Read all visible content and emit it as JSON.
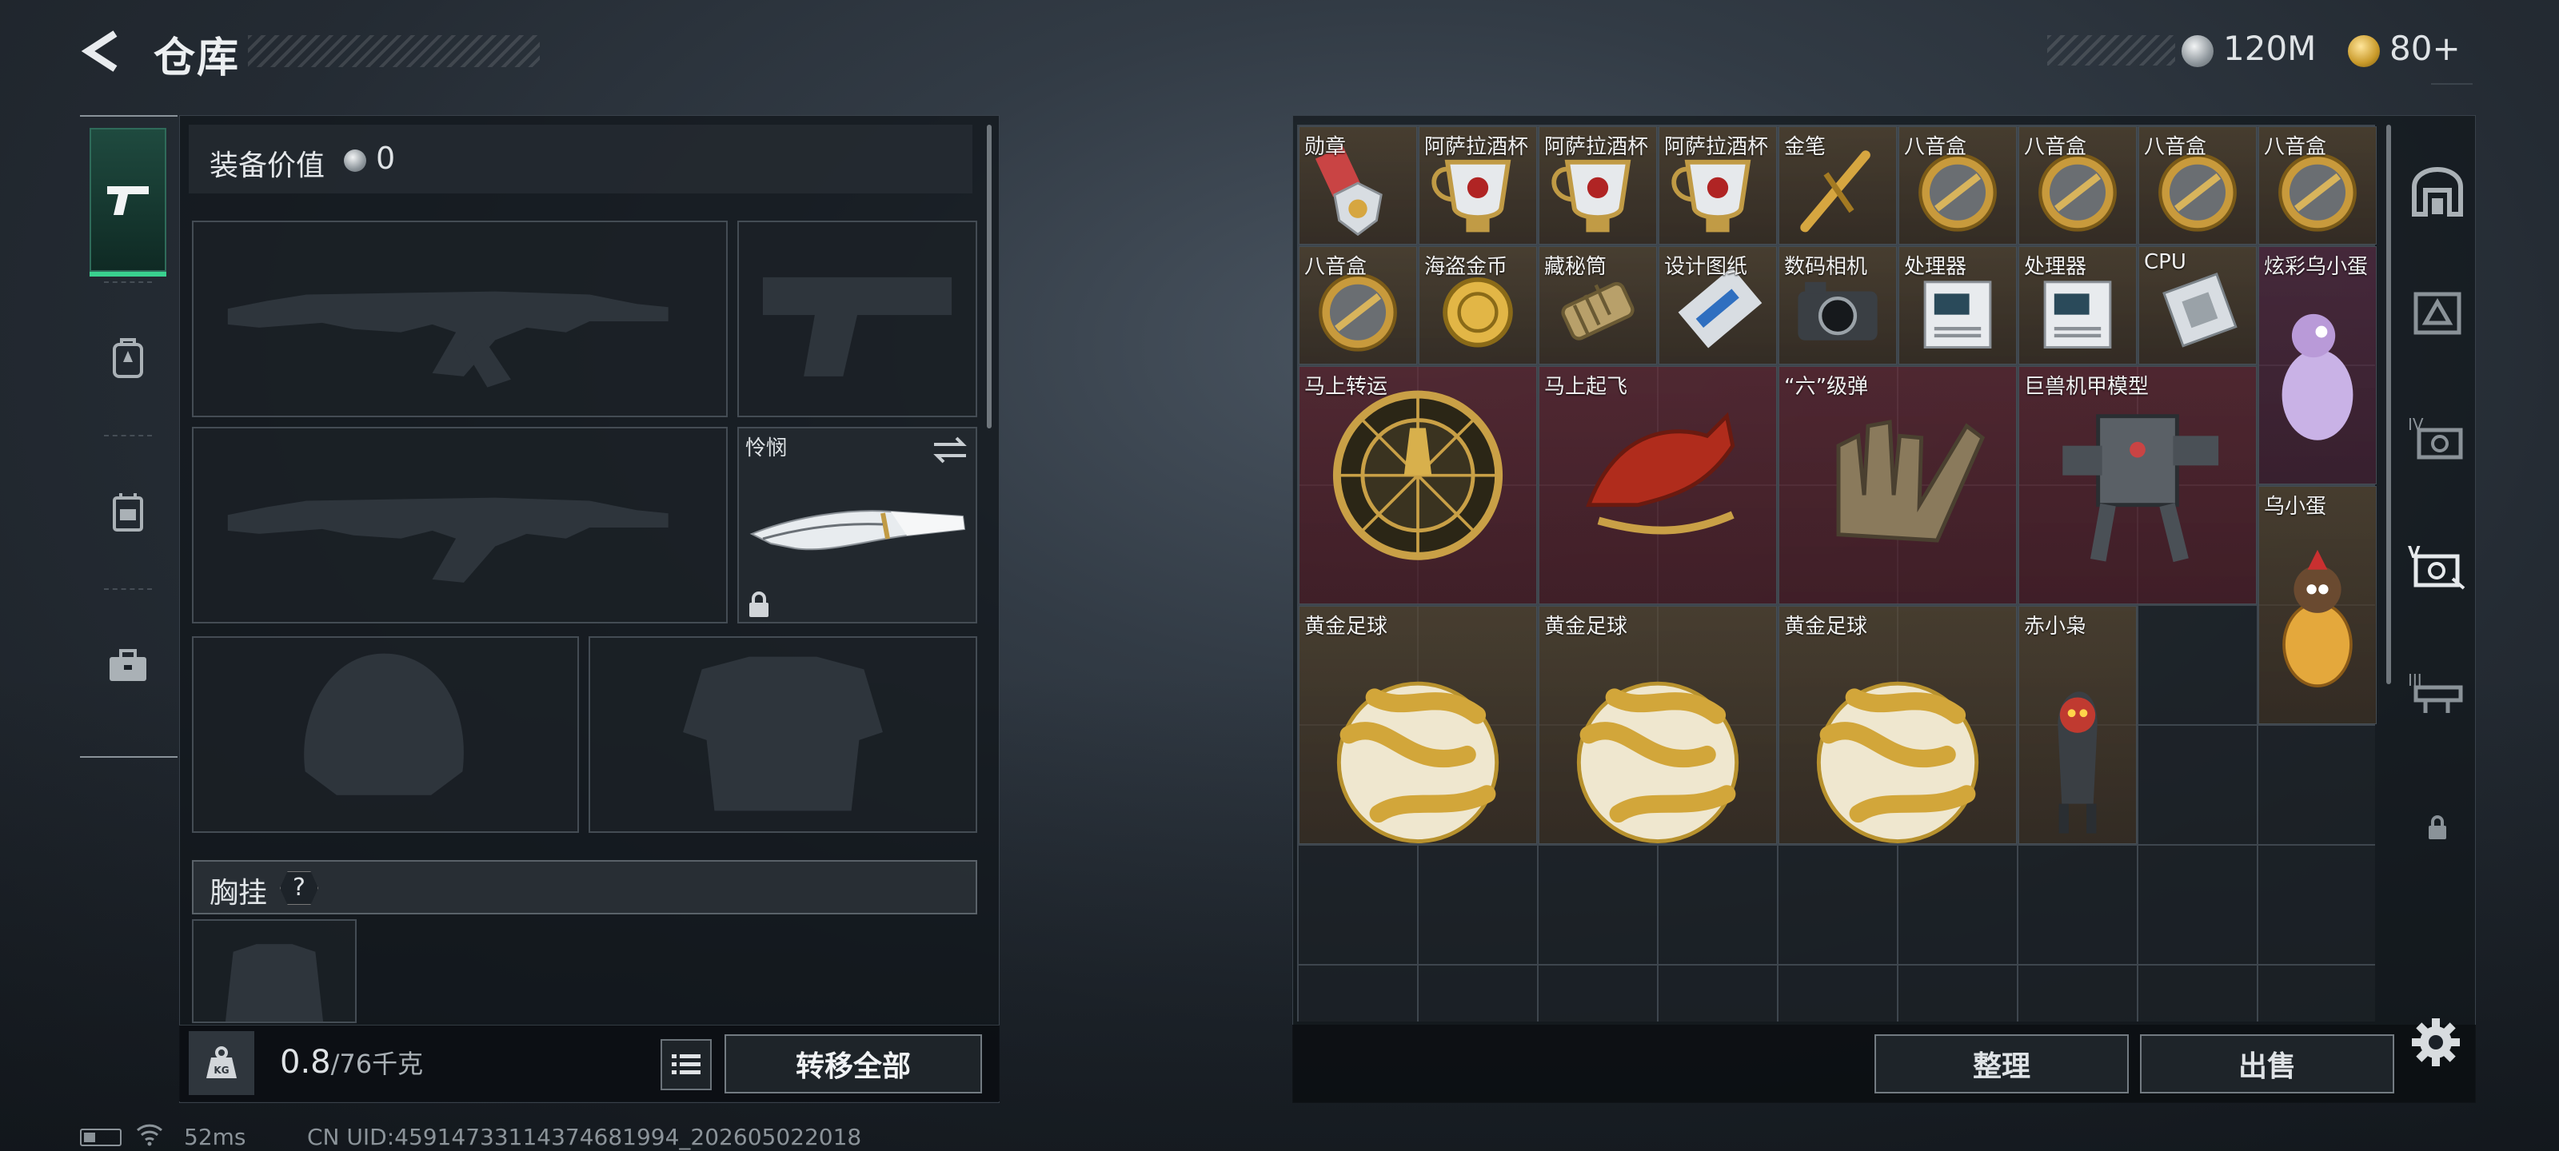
{
  "header": {
    "title": "仓库",
    "currency_silver": "120M",
    "currency_gold": "80+"
  },
  "equipment": {
    "value_label": "装备价值",
    "value": "0",
    "knife_name": "怜悯",
    "chest_label": "胸挂",
    "chest_help": "?",
    "weight_current": "0.8",
    "weight_max": "/76千克",
    "transfer_all": "转移全部"
  },
  "warehouse": {
    "items": [
      {
        "name": "勋章",
        "icon": "medal-icon"
      },
      {
        "name": "阿萨拉酒杯",
        "icon": "cup-icon"
      },
      {
        "name": "阿萨拉酒杯",
        "icon": "cup-icon"
      },
      {
        "name": "阿萨拉酒杯",
        "icon": "cup-icon"
      },
      {
        "name": "金笔",
        "icon": "pen-icon"
      },
      {
        "name": "八音盒",
        "icon": "music-box-icon"
      },
      {
        "name": "八音盒",
        "icon": "music-box-icon"
      },
      {
        "name": "八音盒",
        "icon": "music-box-icon"
      },
      {
        "name": "八音盒",
        "icon": "music-box-icon"
      },
      {
        "name": "八音盒",
        "icon": "music-box-icon"
      },
      {
        "name": "海盗金币",
        "icon": "gold-coin-icon"
      },
      {
        "name": "藏秘筒",
        "icon": "cryptex-icon"
      },
      {
        "name": "设计图纸",
        "icon": "blueprint-icon"
      },
      {
        "name": "数码相机",
        "icon": "camera-icon"
      },
      {
        "name": "处理器",
        "icon": "processor-icon"
      },
      {
        "name": "处理器",
        "icon": "processor-icon"
      },
      {
        "name": "CPU",
        "icon": "cpu-icon"
      },
      {
        "name": "炫彩乌小蛋",
        "icon": "colorful-egg-icon"
      },
      {
        "name": "马上转运",
        "icon": "fortune-wheel-icon"
      },
      {
        "name": "马上起飞",
        "icon": "horse-statue-icon"
      },
      {
        "name": "“六”级弹",
        "icon": "hand-sign-icon"
      },
      {
        "name": "巨兽机甲模型",
        "icon": "mech-model-icon"
      },
      {
        "name": "乌小蛋",
        "icon": "egg-figure-icon"
      },
      {
        "name": "黄金足球",
        "icon": "gold-football-icon"
      },
      {
        "name": "黄金足球",
        "icon": "gold-football-icon"
      },
      {
        "name": "黄金足球",
        "icon": "gold-football-icon"
      },
      {
        "name": "赤小枭",
        "icon": "owl-figure-icon"
      }
    ],
    "sort": "整理",
    "sell": "出售"
  },
  "status": {
    "ping": "52ms",
    "uid": "CN UID:45914733114374681994_202605022018"
  },
  "colors": {
    "accent_green": "#39d18f",
    "rare_red": "#6e2834",
    "rare_gold": "#5c4a32"
  }
}
